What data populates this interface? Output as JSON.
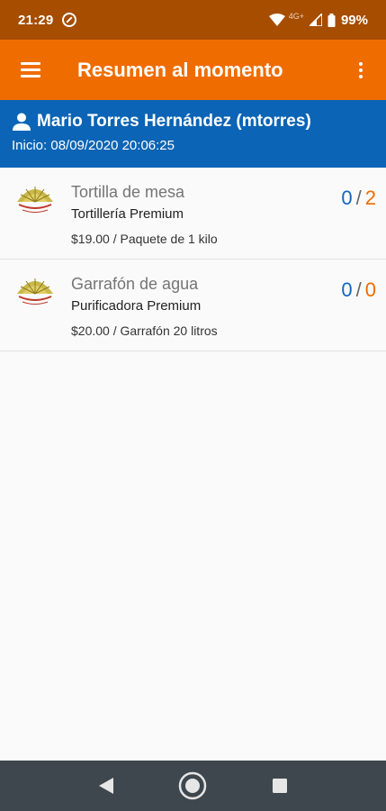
{
  "status": {
    "time": "21:29",
    "network": "4G+",
    "battery": "99%"
  },
  "app_bar": {
    "title": "Resumen al momento",
    "menu_icon": "menu-icon",
    "more_icon": "more-vert-icon"
  },
  "user": {
    "name": "Mario Torres Hernández (mtorres)",
    "start": "Inicio: 08/09/2020 20:06:25"
  },
  "items": [
    {
      "name": "Tortilla de mesa",
      "vendor": "Tortillería Premium",
      "price": "$19.00 / Paquete de 1 kilo",
      "count_a": "0",
      "count_b": "2"
    },
    {
      "name": "Garrafón de agua",
      "vendor": "Purificadora Premium",
      "price": "$20.00 / Garrafón 20 litros",
      "count_a": "0",
      "count_b": "0"
    }
  ],
  "colors": {
    "status_bar": "#a64d00",
    "app_bar": "#ef6c00",
    "user_header": "#0b64b5",
    "count_a": "#1565c0",
    "count_b": "#ef6c00"
  }
}
